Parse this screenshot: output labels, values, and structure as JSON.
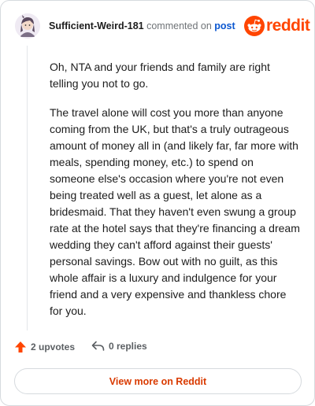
{
  "comment": {
    "username": "Sufficient-Weird-181",
    "action_text": "commented on",
    "post_link": "post",
    "paragraphs": [
      "Oh, NTA and your friends and family are right telling you not to go.",
      "The travel alone will cost you more than anyone coming from the UK, but that's a truly outrageous amount of money all in (and likely far, far more with meals, spending money, etc.) to spend on someone else's occasion where you're not even being treated well as a guest, let alone as a bridesmaid. That they haven't even swung a group rate at the hotel says that they're financing a dream wedding they can't afford against their guests' personal savings. Bow out with no guilt, as this whole affair is a luxury and indulgence for your friend and a very expensive and thankless chore for you."
    ],
    "upvotes": "2 upvotes",
    "replies": "0 replies"
  },
  "brand": {
    "wordmark": "reddit",
    "color": "#ff4500"
  },
  "footer": {
    "view_more": "View more on Reddit"
  },
  "colors": {
    "link": "#0b57d0",
    "upvote": "#ff4500",
    "cta": "#d93a00"
  }
}
